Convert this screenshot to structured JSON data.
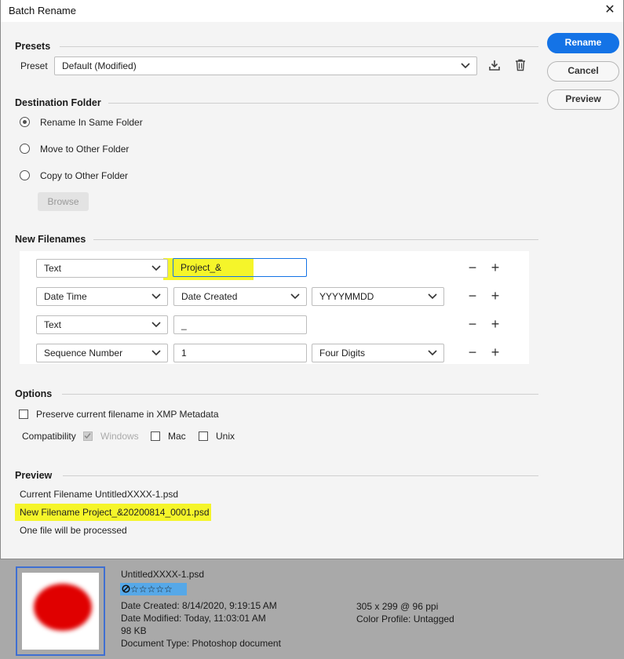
{
  "window": {
    "title": "Batch Rename",
    "close_glyph": "✕"
  },
  "buttons": {
    "rename": "Rename",
    "cancel": "Cancel",
    "preview": "Preview"
  },
  "presets": {
    "heading": "Presets",
    "label": "Preset",
    "selected": "Default (Modified)",
    "icons": [
      "save-preset-icon",
      "trash-icon"
    ]
  },
  "destination": {
    "heading": "Destination Folder",
    "options": [
      "Rename In Same Folder",
      "Move to Other Folder",
      "Copy to Other Folder"
    ],
    "selected_index": 0,
    "browse": "Browse"
  },
  "filenames": {
    "heading": "New Filenames",
    "rows": [
      {
        "type": "Text",
        "value": "Project_&"
      },
      {
        "type": "Date Time",
        "value": "Date Created",
        "format": "YYYYMMDD"
      },
      {
        "type": "Text",
        "value": "_"
      },
      {
        "type": "Sequence Number",
        "value": "1",
        "format": "Four Digits"
      }
    ],
    "minus": "−",
    "plus": "+"
  },
  "options": {
    "heading": "Options",
    "preserve": "Preserve current filename in XMP Metadata",
    "compatibility_label": "Compatibility",
    "windows": "Windows",
    "mac": "Mac",
    "unix": "Unix"
  },
  "preview": {
    "heading": "Preview",
    "current": "Current Filename UntitledXXXX-1.psd",
    "new": "New Filename Project_&20200814_0001.psd",
    "count": "One file will be processed"
  },
  "file_info": {
    "name": "UntitledXXXX-1.psd",
    "rating_stars": "☆☆☆☆☆",
    "rating_value": 0,
    "date_created": "Date Created: 8/14/2020, 9:19:15 AM",
    "date_modified": "Date Modified: Today, 11:03:01 AM",
    "size": "98 KB",
    "doc_type": "Document Type: Photoshop document",
    "dimensions": "305 x 299 @ 96 ppi",
    "color_profile": "Color Profile: Untagged"
  },
  "colors": {
    "accent": "#1473e6",
    "highlight": "#f5f52a",
    "thumb_fill": "#e00000"
  }
}
